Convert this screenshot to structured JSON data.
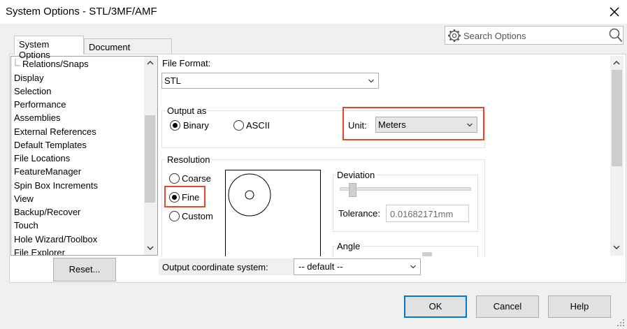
{
  "window": {
    "title": "System Options - STL/3MF/AMF"
  },
  "search": {
    "placeholder": "Search Options"
  },
  "tabs": [
    {
      "label": "System Options",
      "active": true
    },
    {
      "label": "Document Properties",
      "active": false
    }
  ],
  "tree": {
    "items": [
      "Relations/Snaps",
      "Display",
      "Selection",
      "Performance",
      "Assemblies",
      "External References",
      "Default Templates",
      "File Locations",
      "FeatureManager",
      "Spin Box Increments",
      "View",
      "Backup/Recover",
      "Touch",
      "Hole Wizard/Toolbox",
      "File Explorer"
    ]
  },
  "reset_label": "Reset...",
  "file_format": {
    "label": "File Format:",
    "value": "STL"
  },
  "output_as": {
    "title": "Output as",
    "binary_label": "Binary",
    "ascii_label": "ASCII",
    "selected": "Binary"
  },
  "unit": {
    "label": "Unit:",
    "value": "Meters"
  },
  "resolution": {
    "title": "Resolution",
    "coarse_label": "Coarse",
    "fine_label": "Fine",
    "custom_label": "Custom",
    "selected": "Fine"
  },
  "deviation": {
    "title": "Deviation",
    "tolerance_label": "Tolerance:",
    "tolerance_value": "0.01682171mm"
  },
  "angle": {
    "title": "Angle"
  },
  "coord_system": {
    "label": "Output coordinate system:",
    "value": "-- default --"
  },
  "buttons": {
    "ok": "OK",
    "cancel": "Cancel",
    "help": "Help"
  },
  "colors": {
    "highlight": "#e04a2a",
    "primary_border": "#0078d7"
  }
}
